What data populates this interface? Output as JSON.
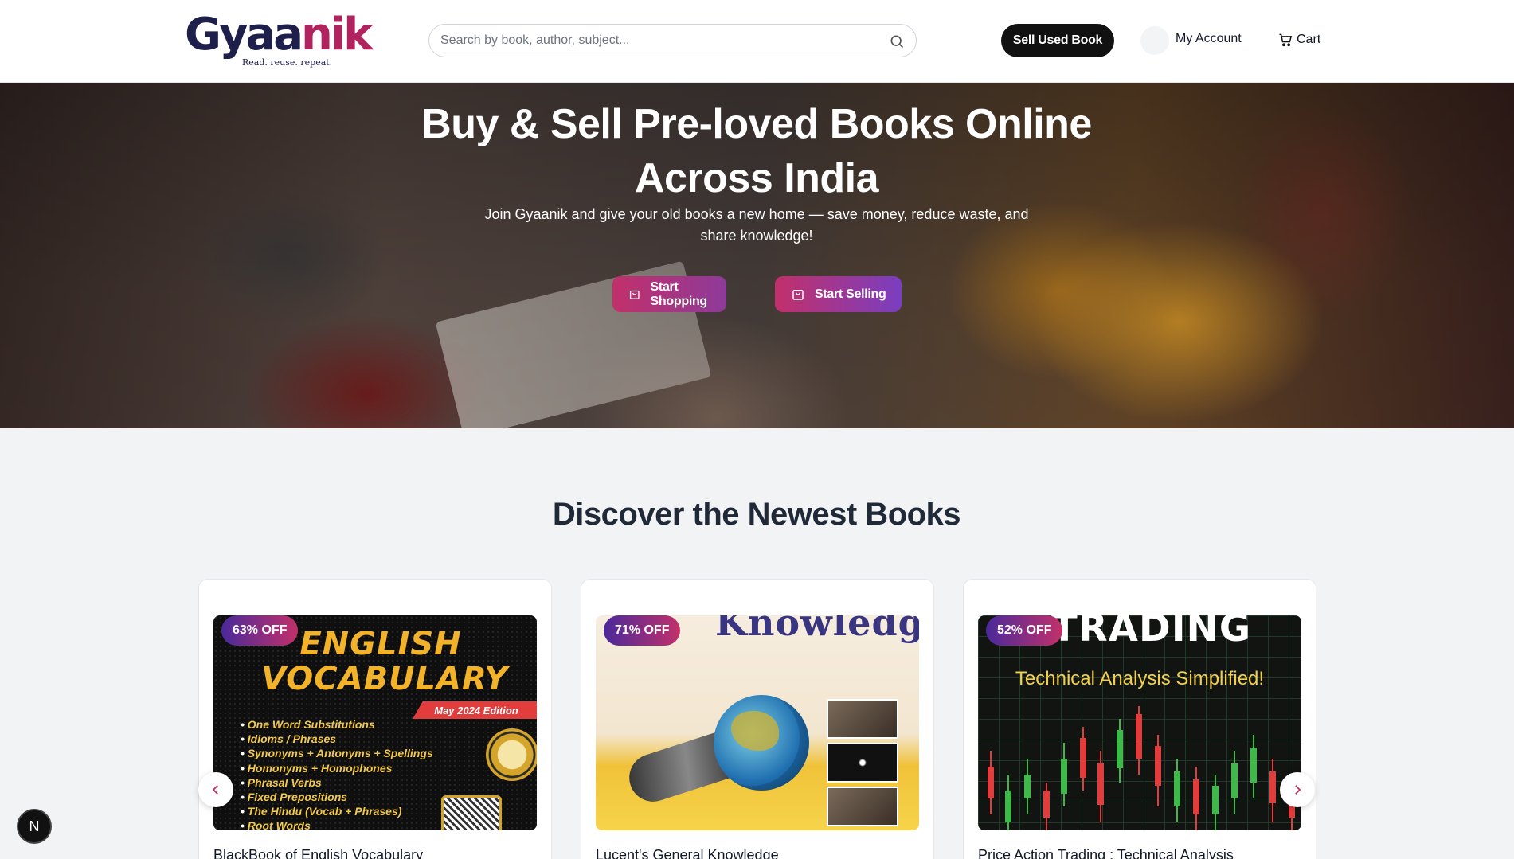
{
  "header": {
    "logo_text_main": "Gyaa",
    "logo_text_accent": "nik",
    "logo_tagline": "Read. reuse. repeat.",
    "search_placeholder": "Search by book, author, subject...",
    "sell_button": "Sell Used Book",
    "account_label": "My Account",
    "cart_label": "Cart"
  },
  "hero": {
    "title": "Buy & Sell Pre-loved Books Online Across India",
    "subtitle": "Join Gyaanik and give your old books a new home — save money, reduce waste, and share knowledge!",
    "shop_button": "Start Shopping",
    "sell_button": "Start Selling"
  },
  "newest": {
    "title": "Discover the Newest Books",
    "books": [
      {
        "discount": "63% OFF",
        "title": "BlackBook of English Vocabulary",
        "cover": {
          "heading": "ENGLISH VOCABULARY",
          "edition": "May 2024 Edition",
          "items": [
            "One Word Substitutions",
            "Idioms / Phrases",
            "Synonyms + Antonyms + Spellings",
            "Homonyms + Homophones",
            "Phrasal Verbs",
            "Fixed Prepositions",
            "The Hindu (Vocab + Phrases)",
            "Root Words"
          ]
        }
      },
      {
        "discount": "71% OFF",
        "title": "Lucent's General Knowledge",
        "cover": {
          "heading": "Knowledge"
        }
      },
      {
        "discount": "52% OFF",
        "title": "Price Action Trading : Technical Analysis",
        "cover": {
          "heading": "TRADING",
          "subheading": "Technical Analysis Simplified!"
        }
      }
    ]
  },
  "floating_badge": "N",
  "colors": {
    "brand_dark": "#1e1f4b",
    "brand_accent": "#b0235f",
    "button_gradient_start": "#c2306a",
    "button_gradient_end": "#7a3ec0"
  }
}
